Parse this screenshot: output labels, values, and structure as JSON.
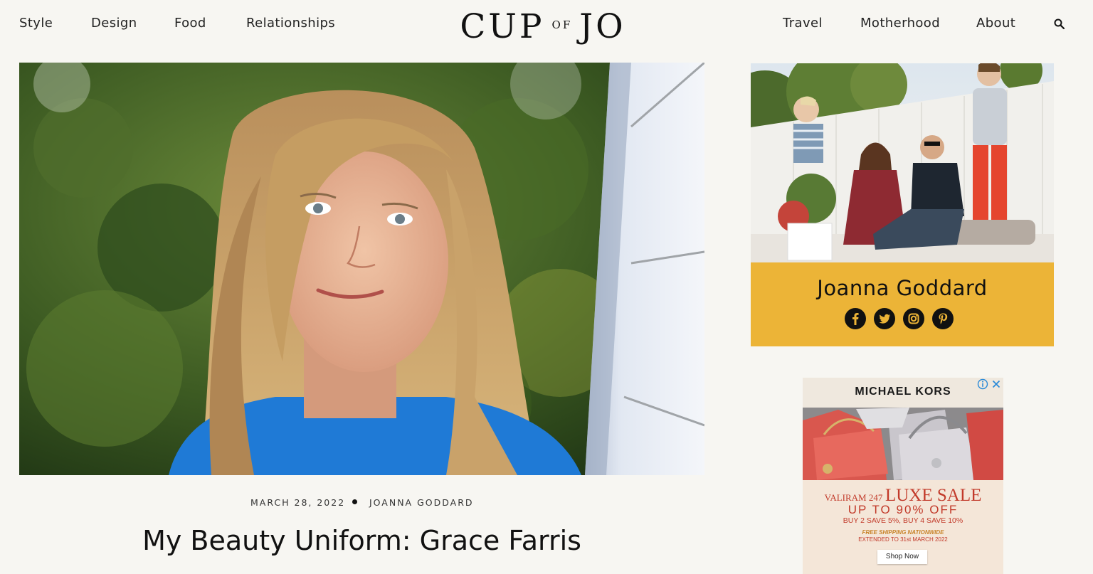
{
  "nav": {
    "left": [
      "Style",
      "Design",
      "Food",
      "Relationships"
    ],
    "right": [
      "Travel",
      "Motherhood",
      "About"
    ]
  },
  "logo": {
    "part1": "CUP",
    "part2": "OF",
    "part3": "JO"
  },
  "icons": {
    "search": "search-icon",
    "facebook": "facebook-icon",
    "twitter": "twitter-icon",
    "instagram": "instagram-icon",
    "pinterest": "pinterest-icon",
    "ad_info": "info-icon",
    "ad_close": "close-icon"
  },
  "post": {
    "date": "MARCH 28, 2022",
    "author": "JOANNA GODDARD",
    "title": "My Beauty Uniform: Grace Farris"
  },
  "sidebar": {
    "name": "Joanna Goddard",
    "accent_color": "#ecb437"
  },
  "ad": {
    "brand": "MICHAEL KORS",
    "store": "VALIRAM 247",
    "sale": "LUXE SALE",
    "offer": "UP TO 90% OFF",
    "deal": "BUY 2 SAVE 5%, BUY 4 SAVE 10%",
    "shipping": "FREE SHIPPING NATIONWIDE",
    "extended": "EXTENDED TO 31st MARCH 2022",
    "cta": "Shop Now"
  }
}
